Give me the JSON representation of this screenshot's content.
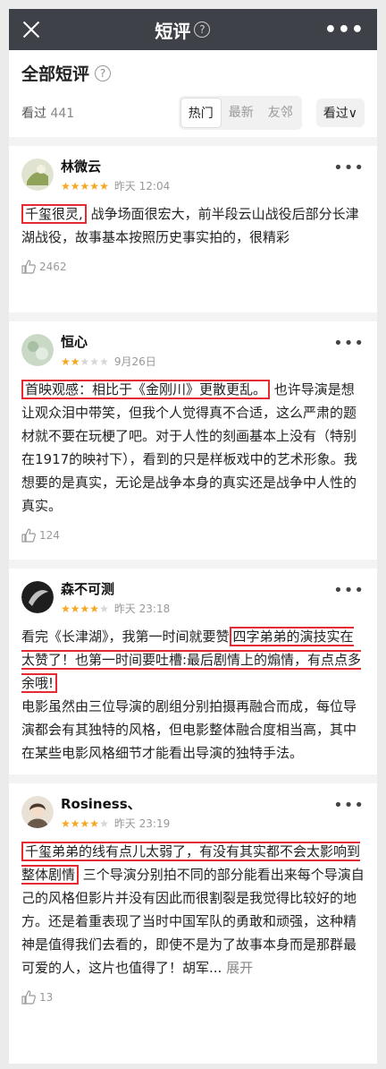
{
  "header": {
    "title": "短评",
    "help": "?",
    "more": "•••"
  },
  "section": {
    "title": "全部短评",
    "help": "?"
  },
  "filters": {
    "seen_label": "看过",
    "seen_count": "441",
    "tabs": [
      "热门",
      "最新",
      "友邻"
    ],
    "sort": "看过∨"
  },
  "reviews": [
    {
      "name": "林微云",
      "rating": 5,
      "time": "昨天 12:04",
      "hl1": "千玺很灵,",
      "text1": "战争场面很宏大，前半段云山战役后部分长津湖战役，故事基本按照历史事实拍的，很精彩",
      "likes": "2462"
    },
    {
      "name": "恒心",
      "rating": 2,
      "time": "9月26日",
      "hl1": "首映观感：相比于《金刚川》更散更乱。",
      "text1": "也许导演是想让观众泪中带笑，但我个人觉得真不合适，这么严肃的题材就不要在玩梗了吧。对于人性的刻画基本上没有（特别在1917的映衬下），看到的只是样板戏中的艺术形象。我想要的是真实，无论是战争本身的真实还是战争中人性的真实。",
      "likes": "124"
    },
    {
      "name": "森不可测",
      "rating": 4,
      "time": "昨天 23:18",
      "text0": "看完《长津湖》，我第一时间就要赞",
      "hl1": "四字弟弟的演技实在太赞了！也第一时间要吐槽:最后剧情上的煽情，有点点多余哦!",
      "text1": "电影虽然由三位导演的剧组分别拍摄再融合而成，每位导演都会有其独特的风格，但电影整体融合度相当高，其中在某些电影风格细节才能看出导演的独特手法。"
    },
    {
      "name": "Rosiness、",
      "rating": 4,
      "time": "昨天 23:19",
      "hl1": "千玺弟弟的线有点儿太弱了，有没有其实都不会太影响到整体剧情",
      "text1": "三个导演分别拍不同的部分能看出来每个导演自己的风格但影片并没有因此而很割裂是我觉得比较好的地方。还是着重表现了当时中国军队的勇敢和顽强，这种精神是值得我们去看的，即使不是为了故事本身而是那群最可爱的人，这片也值得了！胡军...",
      "expand": "展开",
      "likes": "13"
    }
  ],
  "colors": {
    "highlight": "#e52a33",
    "star": "#f5a623",
    "header_bg": "#3e4148"
  }
}
